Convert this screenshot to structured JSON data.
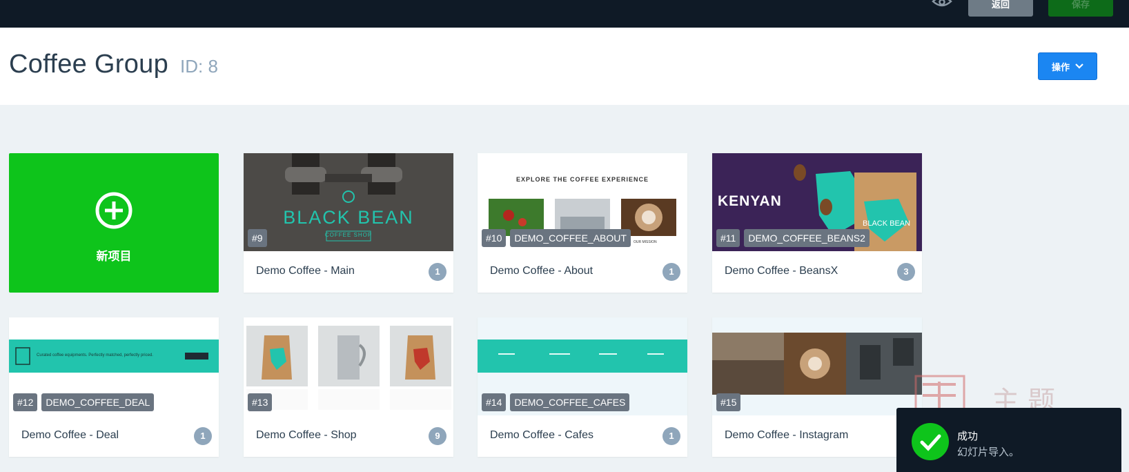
{
  "topbar": {
    "preview_icon": "eye-icon",
    "back_label": "返回",
    "save_label": "保存"
  },
  "header": {
    "title": "Coffee Group",
    "id_text": "ID: 8",
    "actions_label": "操作",
    "actions_icon": "chevron-down-icon"
  },
  "new_item": {
    "icon": "plus-circle-icon",
    "label": "新项目"
  },
  "slides": [
    {
      "number": "#9",
      "tag": "",
      "name": "Demo Coffee - Main",
      "count": "1",
      "thumb_heading": "BLACK BEAN",
      "thumb_sub": "COFFEE SHOP"
    },
    {
      "number": "#10",
      "tag": "DEMO_COFFEE_ABOUT",
      "name": "Demo Coffee - About",
      "count": "1",
      "thumb_heading": "EXPLORE THE COFFEE EXPERIENCE",
      "thumb_sub": "OUR MISSION"
    },
    {
      "number": "#11",
      "tag": "DEMO_COFFEE_BEANS2",
      "name": "Demo Coffee - BeansX",
      "count": "3",
      "thumb_heading": "KENYAN",
      "thumb_sub": "BLACK BEAN"
    },
    {
      "number": "#12",
      "tag": "DEMO_COFFEE_DEAL",
      "name": "Demo Coffee - Deal",
      "count": "1",
      "thumb_heading": "Curated coffee equipments. Perfectly matched, perfectly priced.",
      "thumb_sub": ""
    },
    {
      "number": "#13",
      "tag": "",
      "name": "Demo Coffee - Shop",
      "count": "9",
      "thumb_heading": "",
      "thumb_sub": ""
    },
    {
      "number": "#14",
      "tag": "DEMO_COFFEE_CAFES",
      "name": "Demo Coffee - Cafes",
      "count": "1",
      "thumb_heading": "",
      "thumb_sub": ""
    },
    {
      "number": "#15",
      "tag": "",
      "name": "Demo Coffee - Instagram",
      "count": "",
      "thumb_heading": "",
      "thumb_sub": ""
    }
  ],
  "toast": {
    "icon": "check-circle-icon",
    "title": "成功",
    "message": "幻灯片导入。"
  },
  "watermark": {
    "text": "主题"
  },
  "colors": {
    "topbar_bg": "#0f1a26",
    "new_item_green": "#0ec41b",
    "actions_blue": "#1b86f2",
    "count_badge": "#8fa6bb",
    "teal": "#22c4ad"
  }
}
